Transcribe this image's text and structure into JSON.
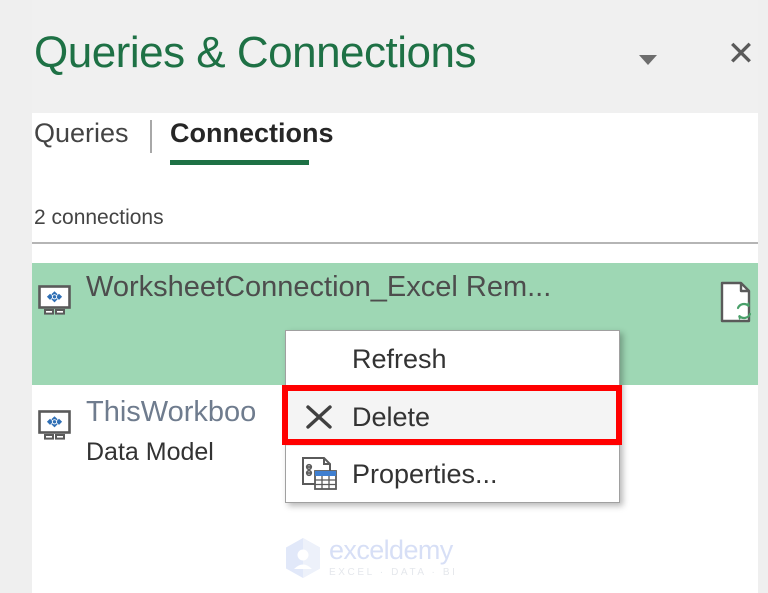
{
  "window": {
    "title": "Queries & Connections",
    "menu_icon": "chevron-down-icon",
    "close_icon": "close-icon",
    "close_glyph": "✕"
  },
  "tabs": [
    {
      "label": "Queries",
      "active": false
    },
    {
      "label": "Connections",
      "active": true
    }
  ],
  "list": {
    "count_label": "2 connections",
    "rows": [
      {
        "name": "WorksheetConnection_Excel Rem...",
        "sub": "",
        "icon": "workbook-connection-icon",
        "selected": true,
        "action_icon": "refresh-document-icon"
      },
      {
        "name": "ThisWorkboo",
        "sub": "Data Model",
        "icon": "workbook-connection-icon",
        "selected": false,
        "action_icon": ""
      }
    ]
  },
  "context_menu": {
    "items": [
      {
        "label": "Refresh",
        "icon": "",
        "selected": false
      },
      {
        "label": "Delete",
        "icon": "delete-x-icon",
        "selected": true
      },
      {
        "label": "Properties...",
        "icon": "properties-table-icon",
        "selected": false
      }
    ]
  },
  "watermark": {
    "name": "exceldemy",
    "tagline": "EXCEL · DATA · BI"
  },
  "colors": {
    "brand_green": "#1e7145",
    "selection_green": "#9ed7b4",
    "annotation_red": "#ff0000",
    "pane_header": "#f0f0f0"
  }
}
